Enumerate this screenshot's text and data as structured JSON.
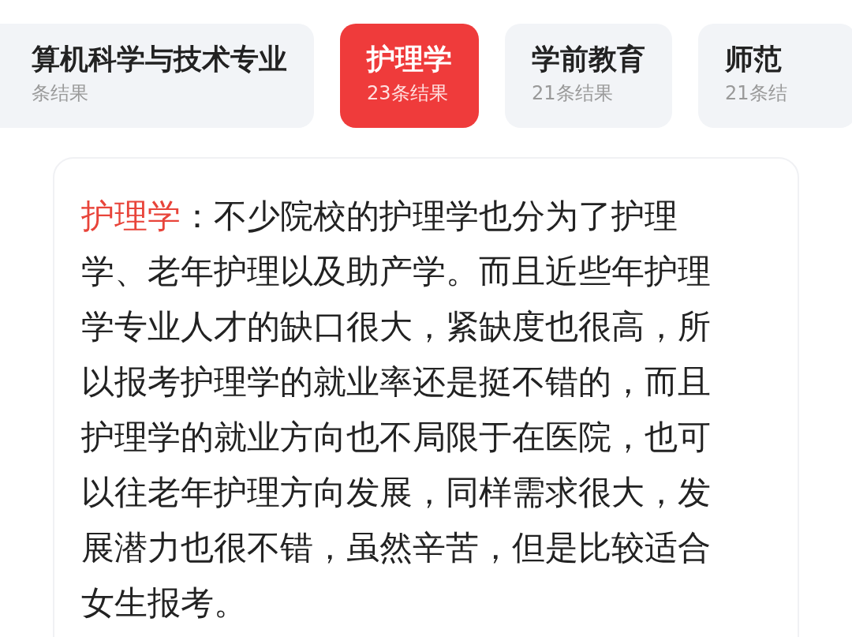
{
  "tabs": [
    {
      "label": "算机科学与技术专业",
      "count": "条结果",
      "selected": false
    },
    {
      "label": "护理学",
      "count": "23条结果",
      "selected": true
    },
    {
      "label": "学前教育",
      "count": "21条结果",
      "selected": false
    },
    {
      "label": "师范",
      "count": "21条结",
      "selected": false
    }
  ],
  "detail": {
    "term": "护理学",
    "text": "：不少院校的护理学也分为了护理学、老年护理以及助产学。而且近些年护理学专业人才的缺口很大，紧缺度也很高，所以报考护理学的就业率还是挺不错的，而且护理学的就业方向也不局限于在医院，也可以往老年护理方向发展，同样需求很大，发展潜力也很不错，虽然辛苦，但是比较适合女生报考。"
  }
}
